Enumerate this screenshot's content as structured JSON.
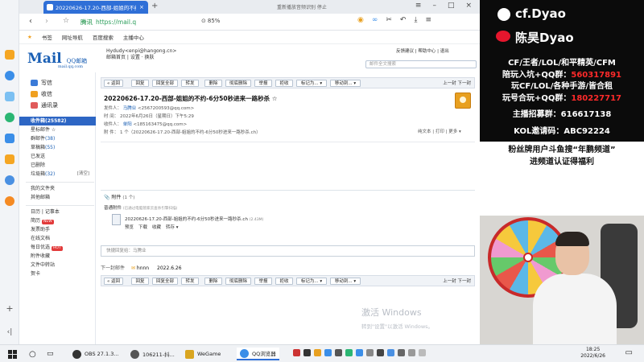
{
  "browser": {
    "tab_title": "20220626-17.20-西部-姐姐的不约-6分50秒进来一路秒杀.mp4",
    "tab_note": "重新播放音频识别 停止",
    "security": "腾讯",
    "url": "https://mail.q",
    "zoom": "85%",
    "bookmarks": [
      "书签",
      "网址导航",
      "百度搜索",
      "主播中心"
    ]
  },
  "mail_header": {
    "logo": "Mail",
    "logo_sub": "QQ邮箱",
    "logo_domain": "mail.qq.com",
    "account": "Hydudy<enpi@hangong.cn>",
    "account_links": "邮箱首页 | 设置 · 换肤",
    "top_links": "反馈建议 | 帮助中心 | 退出",
    "search_placeholder": "邮件全文搜索"
  },
  "nav": {
    "compose": "写信",
    "inbox": "收信",
    "contacts": "通讯录",
    "folders": [
      {
        "label": "收件箱",
        "count": "(25582)",
        "selected": true
      },
      {
        "label": "星标邮件 ☆",
        "count": ""
      },
      {
        "label": "群邮件",
        "count": "(38)"
      },
      {
        "label": "草稿箱",
        "count": "(55)"
      },
      {
        "label": "已发送",
        "count": ""
      },
      {
        "label": "已删除",
        "count": ""
      },
      {
        "label": "垃圾箱",
        "count": "(32)",
        "side": "[清空]"
      }
    ],
    "folders2": [
      {
        "label": "我的文件夹"
      },
      {
        "label": "其他邮箱"
      }
    ],
    "folders3": [
      {
        "label": "日历 | 记事本"
      },
      {
        "label": "简历",
        "hot": "NEW"
      },
      {
        "label": "发票助手"
      },
      {
        "label": "在线文档"
      },
      {
        "label": "每日优选",
        "hot": "HOT"
      },
      {
        "label": "附件收藏"
      },
      {
        "label": "文件中转站"
      },
      {
        "label": "贺卡"
      }
    ]
  },
  "toolbar": {
    "buttons": [
      "« 返回",
      "回复",
      "回复全部",
      "转发",
      "删除",
      "彻底删除",
      "举报",
      "拒收",
      "标记为... ▾",
      "移动到... ▾"
    ],
    "pager": "上一封 下一封"
  },
  "message": {
    "subject": "20220626-17.20-西部-姐姐的不约-6分50秒进来一路秒杀 ☆",
    "from_label": "发件人：",
    "from_name": "马腾业",
    "from_addr": "<2567200593@qq.com>",
    "time_label": "时  间：",
    "time": "2022年6月26日（星期日）下午5:29",
    "to_label": "收件人：",
    "to_name": "单阳",
    "to_addr": "<185163475@qq.com>",
    "att_label": "附  件：",
    "att": "1 个（20220626-17.20-西部-姐姐的不约-6分50秒进来一路秒杀.ch）",
    "right_meta": "纯文本 | 打印 | 更多 ▾"
  },
  "attachment": {
    "heading": "附件",
    "heading_count": "(1 个)",
    "section": "普通附件",
    "section_note": "(已通过电脑管家云查杀引擎扫描)",
    "filename": "20220626-17.20-西部-姐姐的不约-6分50秒进来一路秒杀.ch",
    "filesize": "(2.43M)",
    "actions": [
      "预览",
      "下载",
      "收藏",
      "转存 ▾"
    ]
  },
  "reply_placeholder": "快捷回复给：马腾业",
  "next_mail": {
    "label": "下一封邮件",
    "sender": "hnnn",
    "date": "2022.6.26"
  },
  "watermark": {
    "line1": "激活 Windows",
    "line2": "转到\"设置\"以激活 Windows。"
  },
  "stream": {
    "tiktok": "cf.Dyao",
    "weibo": "陈昊Dyao",
    "lines": [
      {
        "text": "CF/王者/LOL/和平精英/CFM",
        "red": ""
      },
      {
        "text": "陪玩入坑+QQ群：",
        "red": "560317891"
      },
      {
        "text": "玩CF/LOL/各种手游/皆合租",
        "red": ""
      },
      {
        "text": "玩号合玩+QQ群：",
        "red": "180227717"
      },
      {
        "text": "主播招募群：616617138",
        "red": ""
      },
      {
        "text": "KOL邀请码：ABC92224",
        "red": ""
      }
    ],
    "bottom1": "粉丝牌用户斗鱼搜“年鹏频道”",
    "bottom2": "进频道认证得福利"
  },
  "taskbar": {
    "apps": [
      {
        "label": "OBS 27.1.3..."
      },
      {
        "label": "106211-抖..."
      },
      {
        "label": "WeGame"
      },
      {
        "label": "QQ浏览器"
      }
    ],
    "time": "18:25",
    "date": "2022/6/26"
  }
}
